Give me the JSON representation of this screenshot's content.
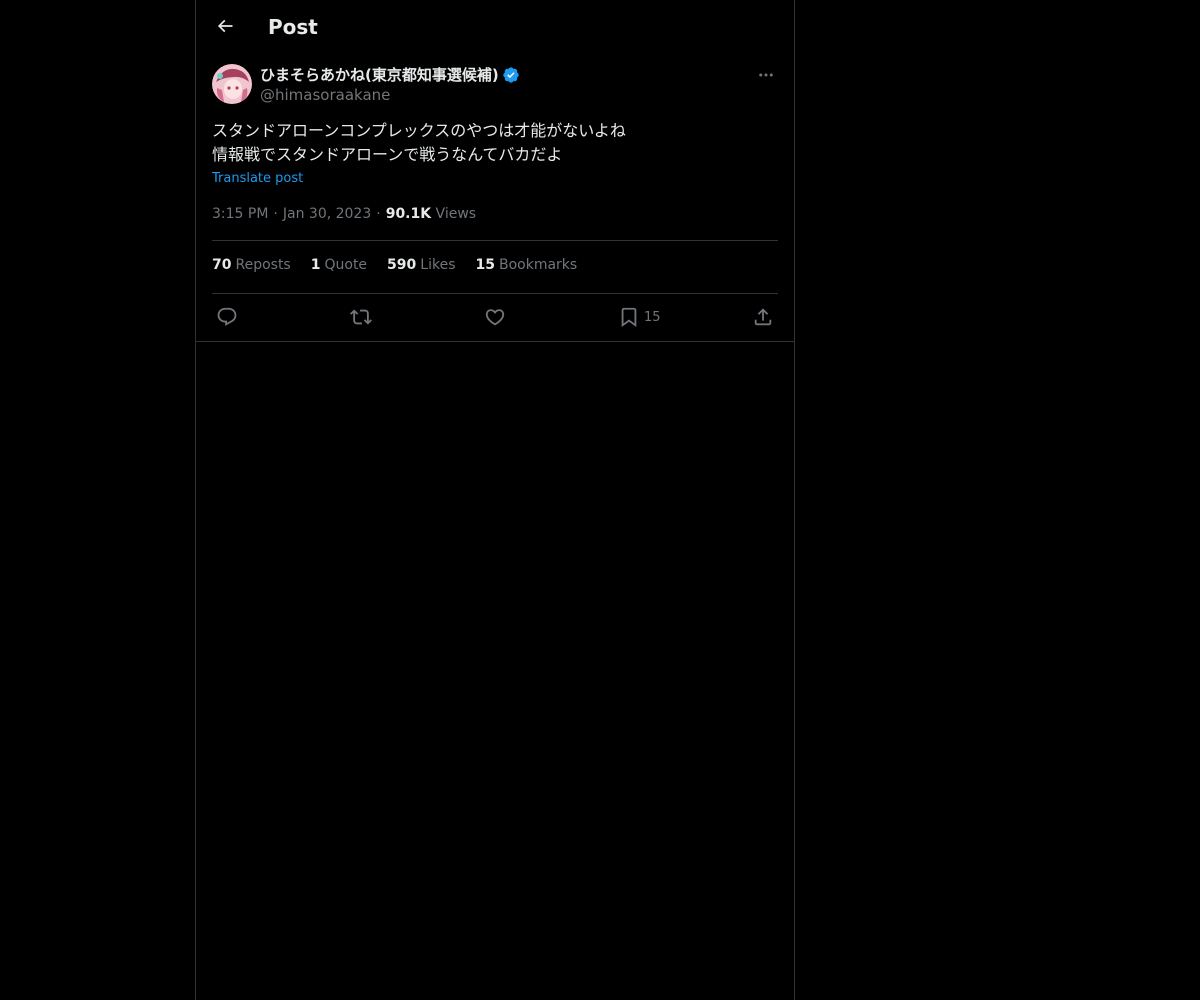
{
  "header": {
    "title": "Post",
    "back_icon": "arrow-left-icon"
  },
  "post": {
    "author": {
      "display_name": "ひまそらあかね(東京都知事選候補)",
      "handle": "@himasoraakane",
      "verified": true,
      "verified_color": "#1d9bf0"
    },
    "text_lines": [
      "スタンドアローンコンプレックスのやつは才能がないよね",
      "情報戦でスタンドアローンで戦うなんてバカだよ"
    ],
    "translate_label": "Translate post",
    "time": "3:15 PM",
    "date": "Jan 30, 2023",
    "views_count": "90.1K",
    "views_label": "Views",
    "separator": "·",
    "stats": {
      "reposts": {
        "count": "70",
        "label": "Reposts"
      },
      "quotes": {
        "count": "1",
        "label": "Quote"
      },
      "likes": {
        "count": "590",
        "label": "Likes"
      },
      "bookmarks": {
        "count": "15",
        "label": "Bookmarks"
      }
    },
    "actions": {
      "reply_icon": "reply-icon",
      "repost_icon": "repost-icon",
      "like_icon": "heart-icon",
      "bookmark_icon": "bookmark-icon",
      "bookmark_count": "15",
      "share_icon": "share-icon"
    }
  },
  "colors": {
    "background": "#000000",
    "text": "#e7e9ea",
    "secondary": "#71767b",
    "accent": "#1d9bf0",
    "border": "#2f3336"
  }
}
